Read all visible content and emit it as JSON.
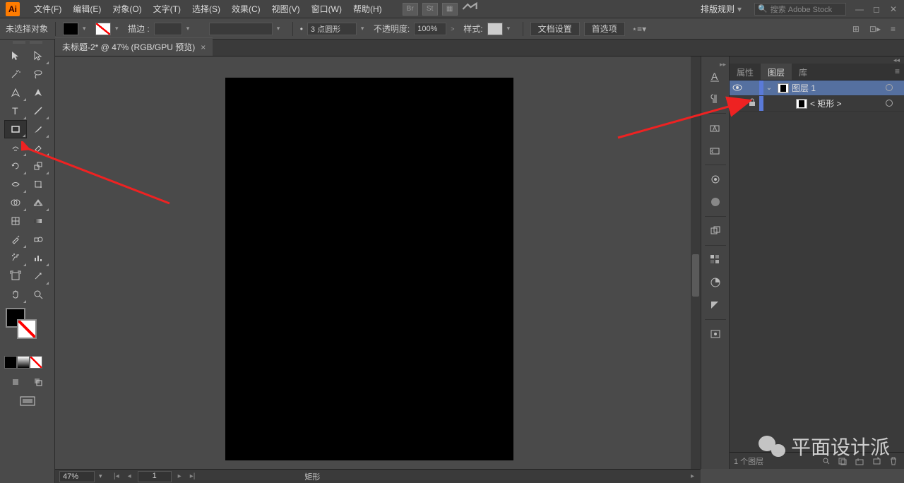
{
  "menubar": {
    "items": [
      "文件(F)",
      "编辑(E)",
      "对象(O)",
      "文字(T)",
      "选择(S)",
      "效果(C)",
      "视图(V)",
      "窗口(W)",
      "帮助(H)"
    ],
    "layout_label": "排版规则",
    "search_placeholder": "搜索 Adobe Stock",
    "bridge": "Br",
    "stock": "St"
  },
  "optbar": {
    "no_selection": "未选择对象",
    "stroke_label": "描边 :",
    "stroke_weight": "",
    "brush_label": "3 点圆形",
    "opacity_label": "不透明度:",
    "opacity_value": "100%",
    "style_label": "样式:",
    "doc_setup": "文档设置",
    "prefs": "首选项"
  },
  "tab": {
    "title": "未标题-2* @ 47% (RGB/GPU 预览)"
  },
  "panels": {
    "tabs": [
      "属性",
      "图层",
      "库"
    ],
    "active_tab": 1,
    "layers": [
      {
        "name": "图层 1",
        "expanded": true,
        "visible": true,
        "locked": false,
        "color": "#5a7ad8",
        "selected": true
      },
      {
        "name": "< 矩形 >",
        "visible": true,
        "locked": true,
        "color": "#5a7ad8",
        "selected": false
      }
    ],
    "footer_count": "1 个图层"
  },
  "status": {
    "zoom": "47%",
    "artboard_num": "1",
    "selection": "矩形"
  },
  "watermark": {
    "text": "平面设计派"
  }
}
